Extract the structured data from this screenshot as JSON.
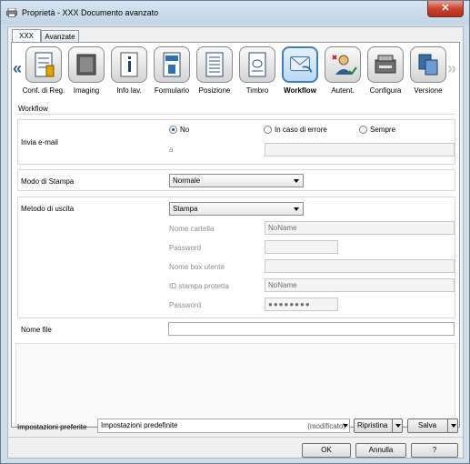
{
  "window": {
    "title": "Proprietà - XXX Documento avanzato",
    "close_label": "✕"
  },
  "tabs": [
    {
      "label": "XXX"
    },
    {
      "label": "Avanzate"
    }
  ],
  "iconbar": {
    "prev_arrow": "«",
    "next_arrow": "»",
    "items": [
      {
        "label": "Conf. di Reg.",
        "icon": "register-settings-icon"
      },
      {
        "label": "Imaging",
        "icon": "imaging-icon"
      },
      {
        "label": "Info lav.",
        "icon": "job-info-icon"
      },
      {
        "label": "Formulario",
        "icon": "form-icon"
      },
      {
        "label": "Posizione",
        "icon": "position-icon"
      },
      {
        "label": "Timbro",
        "icon": "stamp-icon"
      },
      {
        "label": "Workflow",
        "icon": "workflow-icon",
        "selected": true
      },
      {
        "label": "Autent.",
        "icon": "authentication-icon"
      },
      {
        "label": "Configura",
        "icon": "configure-icon"
      },
      {
        "label": "Versione",
        "icon": "version-icon"
      }
    ]
  },
  "workflow": {
    "section_title": "Workflow",
    "email": {
      "label": "Invia e-mail",
      "options": {
        "no": "No",
        "on_error": "In caso di errore",
        "always": "Sempre"
      },
      "to_label": "a",
      "to_value": ""
    },
    "print_mode": {
      "label": "Modo di Stampa",
      "value": "Normale"
    },
    "output": {
      "label": "Metodo di uscita",
      "value": "Stampa",
      "folder_name_label": "Nome cartella",
      "folder_name_value": "NoName",
      "password_label": "Password",
      "password_value": "",
      "user_box_label": "Nome box utente",
      "user_box_value": "",
      "secure_id_label": "ID stampa protetta",
      "secure_id_value": "NoName",
      "secure_password_label": "Password",
      "secure_password_value": "●●●●●●●●"
    },
    "file_name": {
      "label": "Nome file",
      "value": ""
    }
  },
  "favorites": {
    "label": "Impostazioni preferite",
    "value": "Impostazioni predefinite",
    "modified": "(modificato)",
    "restore_label": "Ripristina",
    "save_label": "Salva"
  },
  "buttons": {
    "ok": "OK",
    "cancel": "Annulla",
    "help": "?"
  }
}
